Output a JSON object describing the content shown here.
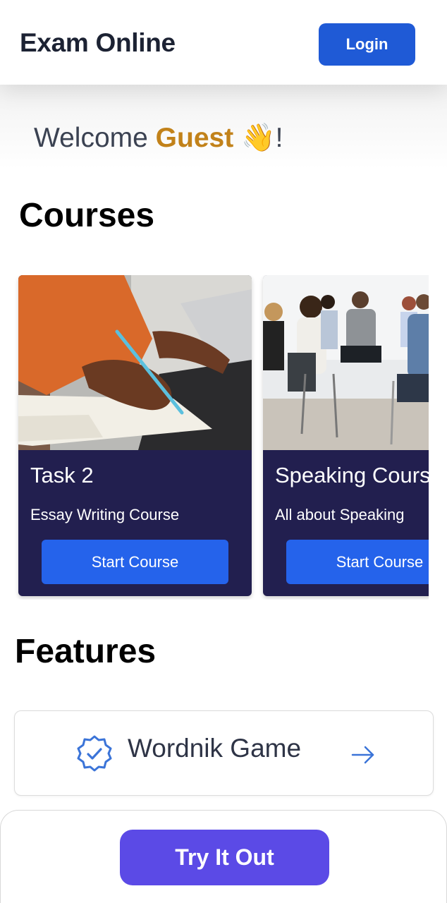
{
  "header": {
    "app_title": "Exam Online",
    "login_label": "Login"
  },
  "welcome": {
    "prefix": "Welcome ",
    "name": "Guest",
    "emoji": "👋",
    "suffix": "!"
  },
  "sections": {
    "courses_title": "Courses",
    "features_title": "Features"
  },
  "courses": [
    {
      "title": "Task 2",
      "subtitle": "Essay Writing Course",
      "button_label": "Start Course",
      "image": "person-writing-in-notebook-photo"
    },
    {
      "title": "Speaking Course",
      "subtitle": "All about Speaking",
      "button_label": "Start Course",
      "image": "group-discussion-circle-photo"
    }
  ],
  "features": [
    {
      "label": "Wordnik Game",
      "icon": "verified-badge-icon",
      "action_icon": "arrow-right-icon"
    }
  ],
  "cta": {
    "label": "Try It Out"
  },
  "colors": {
    "brand_blue": "#1f5ad6",
    "card_bg": "#221f4f",
    "card_button": "#2563eb",
    "guest_accent": "#c2821a",
    "cta_purple": "#5b4ae6",
    "icon_blue": "#3b74d8"
  }
}
